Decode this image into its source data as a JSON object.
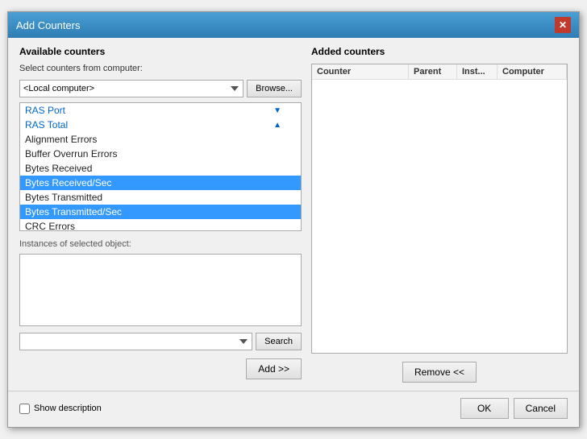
{
  "dialog": {
    "title": "Add Counters",
    "close_label": "✕"
  },
  "left_panel": {
    "title": "Available counters",
    "select_label": "Select counters from computer:",
    "computer_value": "<Local computer>",
    "browse_label": "Browse...",
    "counters": [
      {
        "id": "ras-port",
        "label": "RAS Port",
        "type": "group",
        "expanded": false
      },
      {
        "id": "ras-total",
        "label": "RAS Total",
        "type": "group",
        "expanded": true
      },
      {
        "id": "alignment-errors",
        "label": "Alignment Errors",
        "type": "item"
      },
      {
        "id": "buffer-overrun-errors",
        "label": "Buffer Overrun Errors",
        "type": "item"
      },
      {
        "id": "bytes-received",
        "label": "Bytes Received",
        "type": "item"
      },
      {
        "id": "bytes-received-sec",
        "label": "Bytes Received/Sec",
        "type": "item",
        "selected": true
      },
      {
        "id": "bytes-transmitted",
        "label": "Bytes Transmitted",
        "type": "item"
      },
      {
        "id": "bytes-transmitted-sec",
        "label": "Bytes Transmitted/Sec",
        "type": "item",
        "selected": true
      },
      {
        "id": "crc-errors",
        "label": "CRC Errors",
        "type": "item"
      }
    ],
    "instances_label": "Instances of selected object:",
    "search_placeholder": "",
    "search_label": "Search",
    "add_label": "Add >>"
  },
  "right_panel": {
    "title": "Added counters",
    "columns": [
      "Counter",
      "Parent",
      "Inst...",
      "Computer"
    ],
    "remove_label": "Remove <<"
  },
  "footer": {
    "show_description_label": "Show description",
    "ok_label": "OK",
    "cancel_label": "Cancel"
  }
}
